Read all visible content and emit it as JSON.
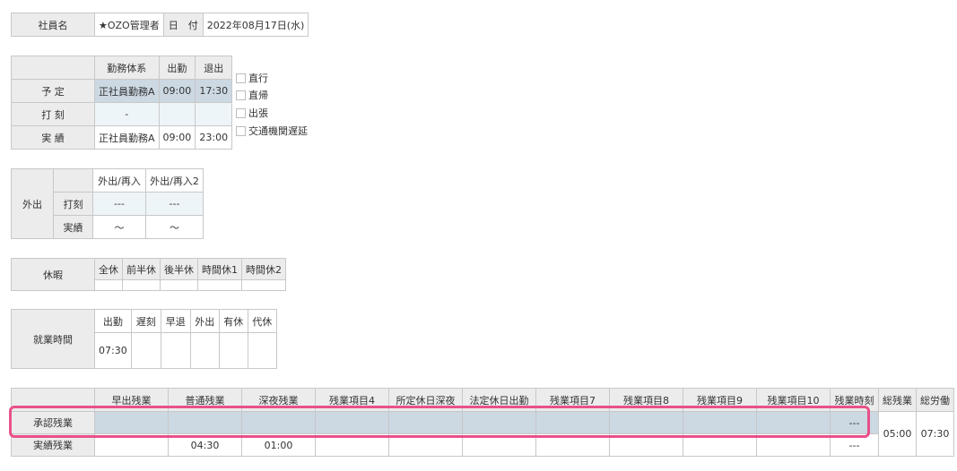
{
  "employee": {
    "name_label": "社員名",
    "name": "★OZO管理者",
    "date_label": "日　付",
    "date": "2022年08月17日(水)"
  },
  "schedule": {
    "headers": [
      "勤務体系",
      "出勤",
      "退出"
    ],
    "rows": [
      {
        "label": "予 定",
        "type": "正社員勤務A",
        "in": "09:00",
        "out": "17:30"
      },
      {
        "label": "打 刻",
        "type": "-",
        "in": "",
        "out": ""
      },
      {
        "label": "実 績",
        "type": "正社員勤務A",
        "in": "09:00",
        "out": "23:00"
      }
    ]
  },
  "checkboxes": [
    {
      "label": "直行",
      "checked": false
    },
    {
      "label": "直帰",
      "checked": false
    },
    {
      "label": "出張",
      "checked": false
    },
    {
      "label": "交通機関遅延",
      "checked": false
    }
  ],
  "outing": {
    "label": "外出",
    "headers": [
      "外出/再入",
      "外出/再入2"
    ],
    "rows": [
      {
        "label": "打刻",
        "values": [
          "---",
          "---"
        ]
      },
      {
        "label": "実績",
        "values": [
          "～",
          "～"
        ]
      }
    ]
  },
  "leave": {
    "label": "休暇",
    "headers": [
      "全休",
      "前半休",
      "後半休",
      "時間休1",
      "時間休2"
    ]
  },
  "work_hours": {
    "label": "就業時間",
    "headers": [
      "出勤",
      "遅刻",
      "早退",
      "外出",
      "有休",
      "代休"
    ],
    "values": [
      "07:30",
      "",
      "",
      "",
      "",
      ""
    ]
  },
  "overtime": {
    "headers": [
      "早出残業",
      "普通残業",
      "深夜残業",
      "残業項目4",
      "所定休日深夜",
      "法定休日出勤",
      "残業項目7",
      "残業項目8",
      "残業項目9",
      "残業項目10",
      "残業時刻",
      "総残業",
      "総労働"
    ],
    "rows": [
      {
        "label": "承認残業",
        "values": [
          "",
          "",
          "",
          "",
          "",
          "",
          "",
          "",
          "",
          "",
          "---"
        ]
      },
      {
        "label": "実績残業",
        "values": [
          "",
          "04:30",
          "01:00",
          "",
          "",
          "",
          "",
          "",
          "",
          "",
          "---"
        ]
      }
    ],
    "total_overtime": "05:00",
    "total_work": "07:30"
  }
}
